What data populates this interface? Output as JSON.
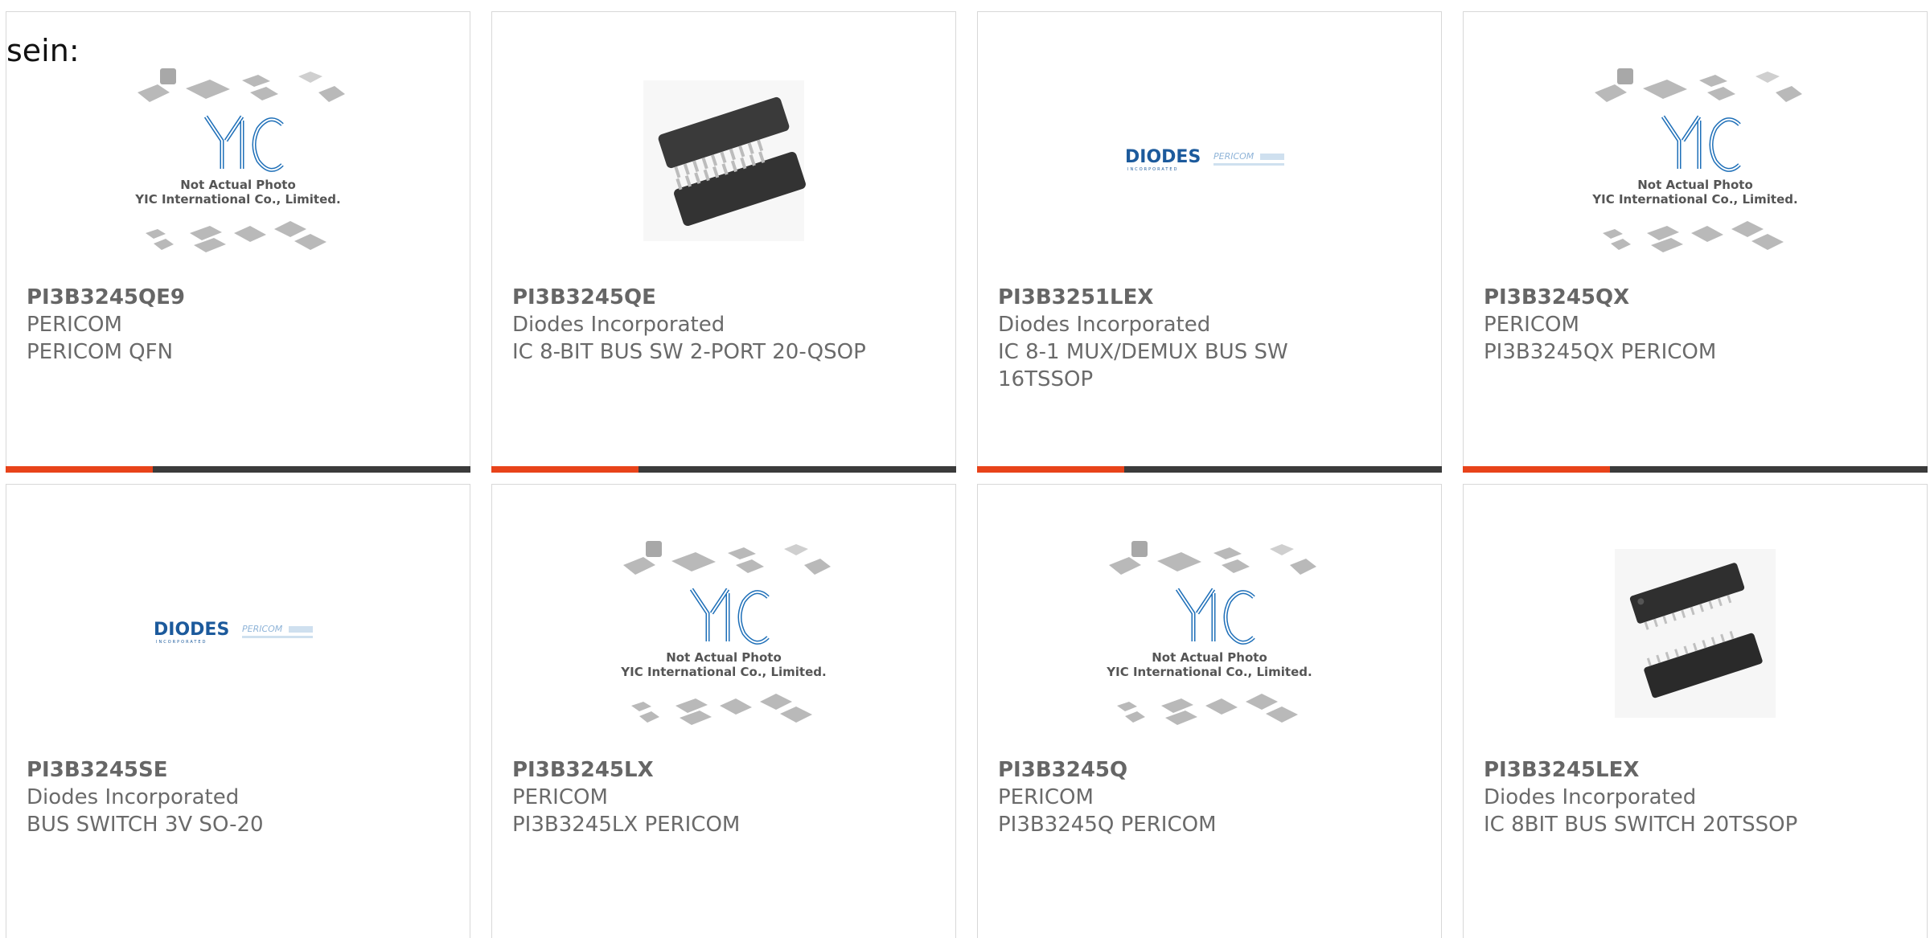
{
  "intro": {
    "text": "sein:"
  },
  "colors": {
    "accent": "#e8431a",
    "bar_dark": "#3b3b3b",
    "yic_blue": "#1e6fb8",
    "diodes_blue": "#1c5a9c"
  },
  "placeholder": {
    "line1": "Not Actual Photo",
    "line2": "YIC International Co., Limited."
  },
  "brands": {
    "diodes": "DIODES",
    "diodes_sub": "INCORPORATED",
    "pericom": "PERICOM"
  },
  "cards": [
    {
      "part": "PI3B3245QE9",
      "manufacturer": "PERICOM",
      "description": "PERICOM QFN",
      "image": "yic-placeholder-icon"
    },
    {
      "part": "PI3B3245QE",
      "manufacturer": "Diodes Incorporated",
      "description": "IC 8-BIT BUS SW 2-PORT 20-QSOP",
      "image": "qsop-chip-icon"
    },
    {
      "part": "PI3B3251LEX",
      "manufacturer": "Diodes Incorporated",
      "description": "IC 8-1 MUX/DEMUX BUS SW 16TSSOP",
      "image": "diodes-pericom-logo"
    },
    {
      "part": "PI3B3245QX",
      "manufacturer": "PERICOM",
      "description": "PI3B3245QX PERICOM",
      "image": "yic-placeholder-icon"
    },
    {
      "part": "PI3B3245SE",
      "manufacturer": "Diodes Incorporated",
      "description": "BUS SWITCH 3V SO-20",
      "image": "diodes-pericom-logo"
    },
    {
      "part": "PI3B3245LX",
      "manufacturer": "PERICOM",
      "description": "PI3B3245LX PERICOM",
      "image": "yic-placeholder-icon"
    },
    {
      "part": "PI3B3245Q",
      "manufacturer": "PERICOM",
      "description": "PI3B3245Q PERICOM",
      "image": "yic-placeholder-icon"
    },
    {
      "part": "PI3B3245LEX",
      "manufacturer": "Diodes Incorporated",
      "description": "IC 8BIT BUS SWITCH 20TSSOP",
      "image": "tssop-chip-icon"
    }
  ]
}
